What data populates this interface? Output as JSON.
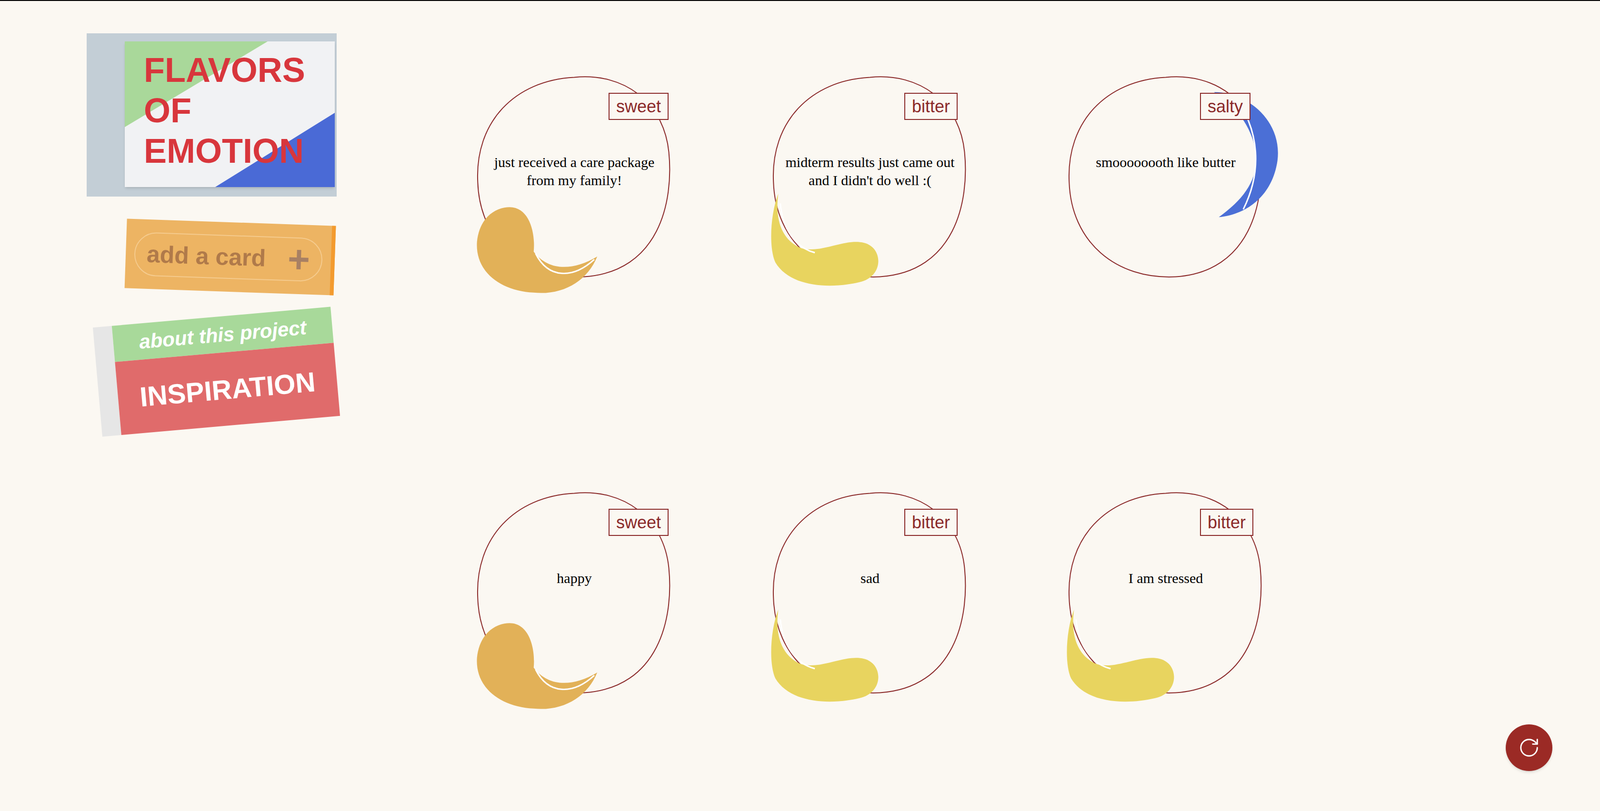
{
  "logo": {
    "lines": [
      "FLAVORS",
      "OF",
      "EMOTION"
    ]
  },
  "add_button": {
    "label": "add a card",
    "icon": "+"
  },
  "inspiration_button": {
    "subtitle": "about this project",
    "title": "INSPIRATION"
  },
  "cards": [
    {
      "flavor": "sweet",
      "text": "just received a care package from my family!",
      "color": "#e2b158",
      "kind": "drop"
    },
    {
      "flavor": "bitter",
      "text": "midterm results just came out and I didn't do well :(",
      "color": "#e8d45f",
      "kind": "leaf"
    },
    {
      "flavor": "salty",
      "text": "smoooooooth like butter",
      "color": "#4b6fd6",
      "kind": "feather"
    },
    {
      "flavor": "sweet",
      "text": "happy",
      "color": "#e2b158",
      "kind": "drop"
    },
    {
      "flavor": "bitter",
      "text": "sad",
      "color": "#e8d45f",
      "kind": "leaf"
    },
    {
      "flavor": "bitter",
      "text": "I am stressed",
      "color": "#e8d45f",
      "kind": "leaf"
    }
  ]
}
